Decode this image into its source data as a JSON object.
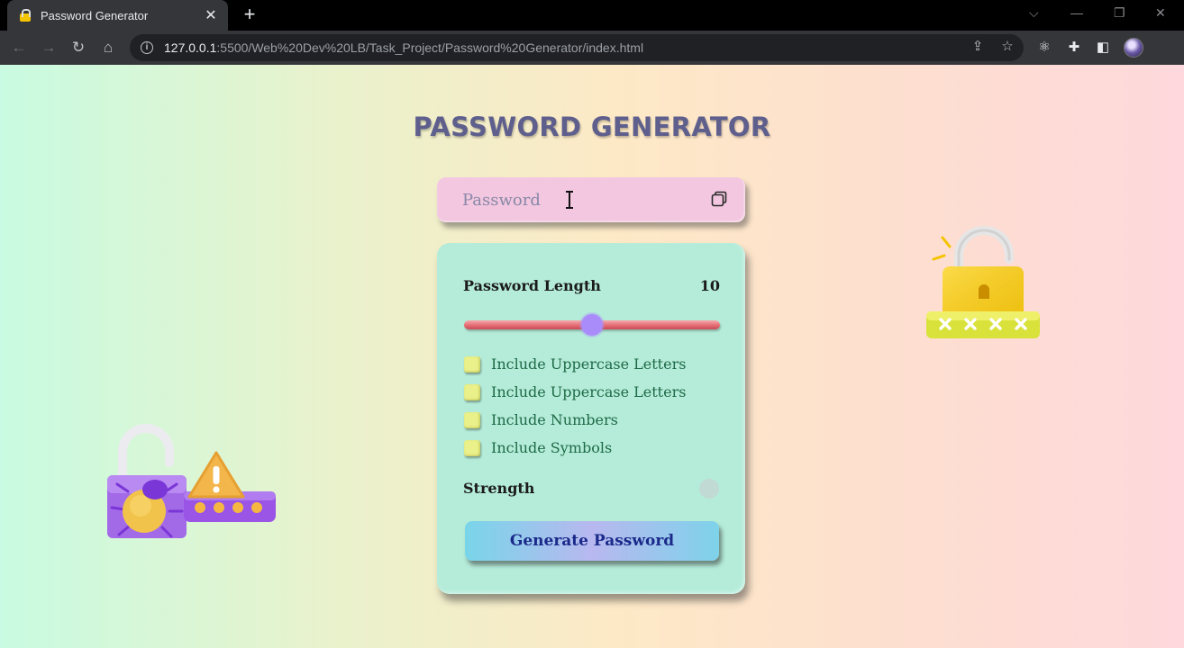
{
  "browser": {
    "tab_title": "Password Generator",
    "tab_close": "✕",
    "new_tab": "+",
    "url_host": "127.0.0.1",
    "url_path": ":5500/Web%20Dev%20LB/Task_Project/Password%20Generator/index.html"
  },
  "page": {
    "title": "PASSWORD GENERATOR",
    "password_placeholder": "Password",
    "length_label": "Password Length",
    "length_value": "10",
    "length_slider_fraction": 0.5,
    "options": [
      {
        "label": "Include Uppercase Letters",
        "checked": false
      },
      {
        "label": "Include Uppercase Letters",
        "checked": false
      },
      {
        "label": "Include Numbers",
        "checked": false
      },
      {
        "label": "Include Symbols",
        "checked": false
      }
    ],
    "strength_label": "Strength",
    "generate_label": "Generate Password"
  },
  "colors": {
    "title": "#5e5f8c",
    "password_box": "#f3c7df",
    "panel": "#b5ecd9",
    "slider_thumb": "#a98cf9",
    "checkbox": "#eaf08a",
    "option_text": "#1e6a47",
    "button_text": "#1b2a8a"
  }
}
